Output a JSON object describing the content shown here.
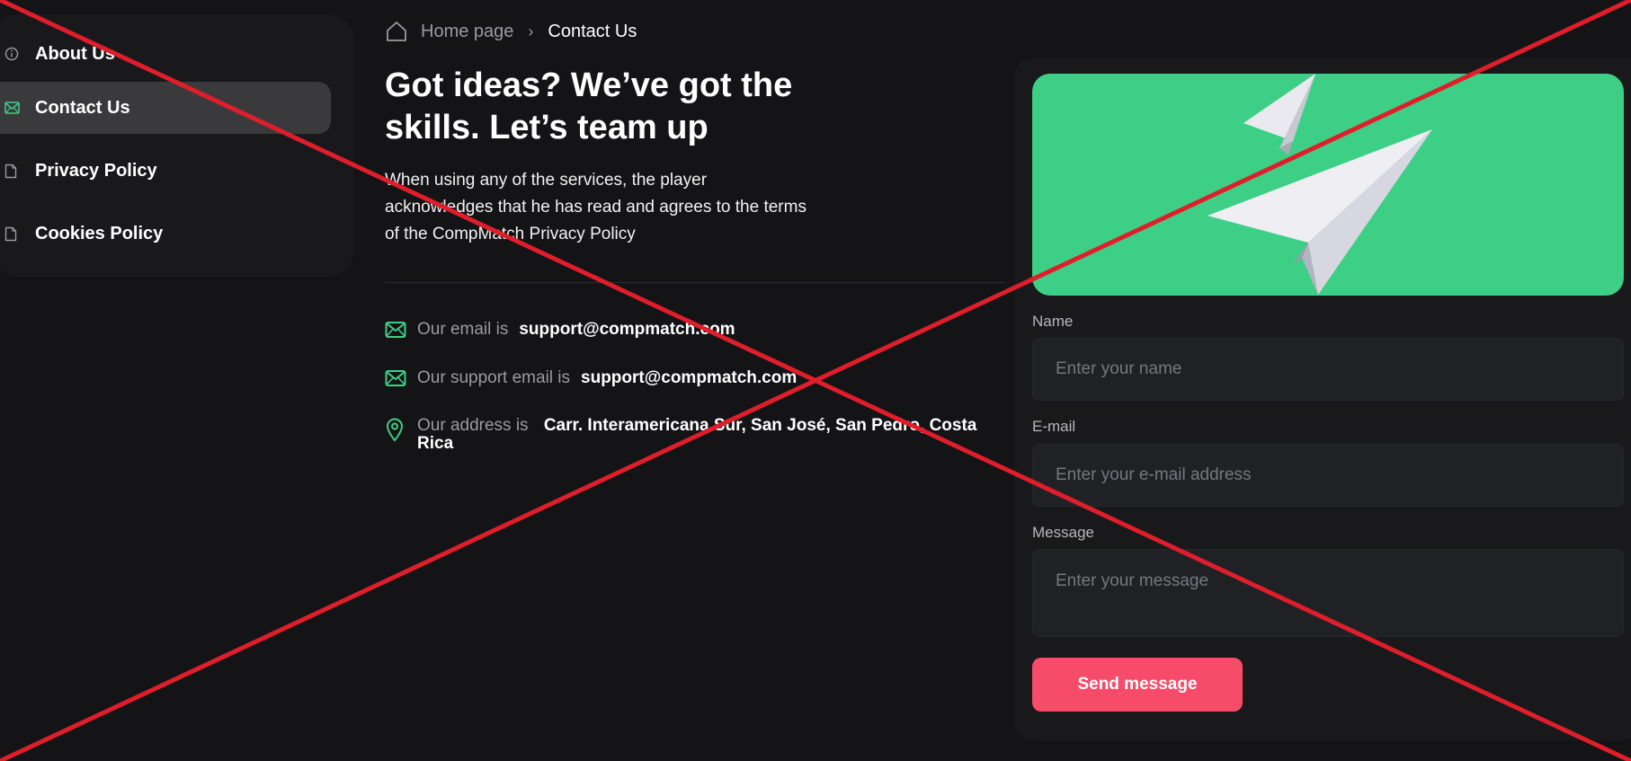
{
  "sidebar": {
    "items": [
      {
        "label": "About Us",
        "icon": "info-icon"
      },
      {
        "label": "Contact Us",
        "icon": "mail-icon",
        "active": true
      },
      {
        "label": "Privacy Policy",
        "icon": "document-icon"
      },
      {
        "label": "Cookies Policy",
        "icon": "document-icon"
      }
    ]
  },
  "breadcrumb": {
    "home": "Home page",
    "separator": "›",
    "current": "Contact Us"
  },
  "main": {
    "title": "Got ideas? We’ve got the skills. Let’s team up",
    "intro": "When using any of the services, the player acknowledges that he has read and agrees to the terms of the CompMatch Privacy Policy",
    "contacts": [
      {
        "prefix": "Our email is",
        "value": "support@compmatch.com",
        "icon": "mail-icon"
      },
      {
        "prefix": "Our support email is",
        "value": "support@compmatch.com",
        "icon": "mail-icon"
      },
      {
        "prefix": "Our address is",
        "value": "Carr. Interamericana Sur, San José, San Pedro, Costa Rica",
        "icon": "location-pin-icon"
      }
    ]
  },
  "form": {
    "name_label": "Name",
    "name_placeholder": "Enter your name",
    "email_label": "E-mail",
    "email_placeholder": "Enter your e-mail address",
    "message_label": "Message",
    "message_placeholder": "Enter your message",
    "submit_label": "Send message",
    "hero_icon": "paper-plane-icon"
  },
  "colors": {
    "background": "#141416",
    "accent_green": "#3ecf86",
    "button": "#f64b69",
    "overlay_cross": "#e01e2b"
  }
}
